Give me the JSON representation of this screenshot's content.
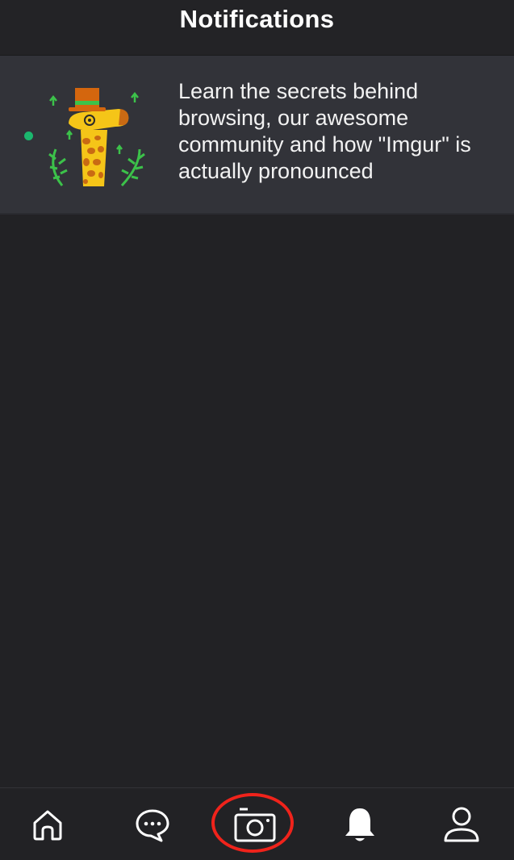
{
  "header": {
    "title": "Notifications"
  },
  "notification": {
    "unread": true,
    "text": "Learn the secrets behind browsing, our awesome community and how \"Imgur\" is actually pronounced",
    "illustration_icon": "giraffe-mascot-icon"
  },
  "tabbar": {
    "items": [
      {
        "name": "home",
        "icon": "home-icon"
      },
      {
        "name": "chat",
        "icon": "chat-bubble-icon"
      },
      {
        "name": "camera",
        "icon": "camera-icon",
        "highlighted": true
      },
      {
        "name": "notifications",
        "icon": "bell-icon",
        "selected": true
      },
      {
        "name": "profile",
        "icon": "user-icon"
      }
    ]
  },
  "colors": {
    "background": "#222225",
    "card": "#323339",
    "unread_dot": "#1bb76e",
    "highlight": "#f0231b",
    "icon": "#ffffff"
  }
}
